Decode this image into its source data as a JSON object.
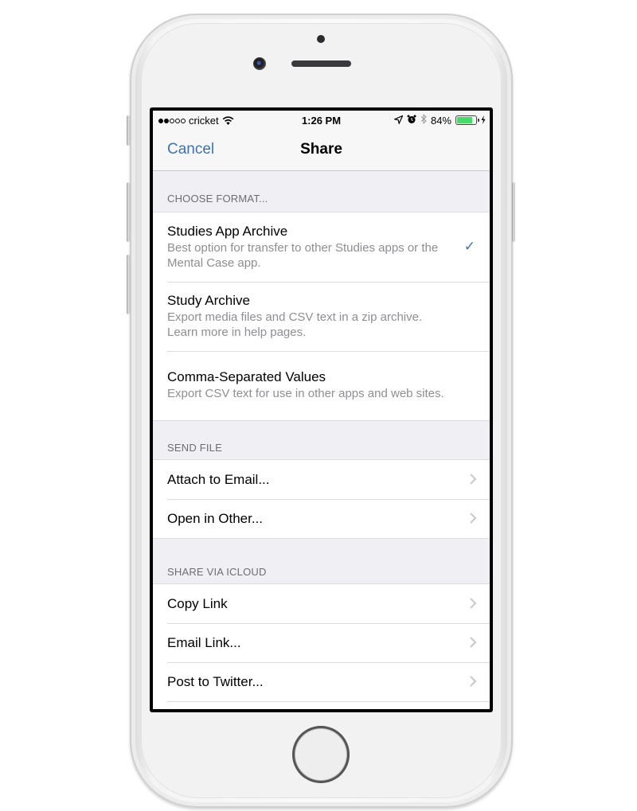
{
  "status_bar": {
    "signal_total": 5,
    "signal_filled": 2,
    "carrier": "cricket",
    "time": "1:26 PM",
    "battery_percent_label": "84%",
    "battery_level": 0.84,
    "icons": [
      "wifi-icon",
      "location-arrow-icon",
      "alarm-clock-icon",
      "bluetooth-icon",
      "battery-icon",
      "charging-bolt-icon"
    ]
  },
  "nav": {
    "cancel_label": "Cancel",
    "title": "Share"
  },
  "colors": {
    "accent": "#3d74ad",
    "battery_green": "#4cd964",
    "grouped_background": "#efeff4",
    "secondary_text": "#8e8e93"
  },
  "sections": {
    "format": {
      "header": "Choose Format...",
      "items": [
        {
          "title": "Studies App Archive",
          "subtitle": "Best option for transfer to other Studies apps or the Mental Case app.",
          "selected": true
        },
        {
          "title": "Study Archive",
          "subtitle": "Export media files and CSV text in a zip archive. Learn more in help pages.",
          "selected": false
        },
        {
          "title": "Comma-Separated Values",
          "subtitle": "Export CSV text for use in other apps and web sites.",
          "selected": false
        }
      ],
      "check_glyph": "✓"
    },
    "send_file": {
      "header": "Send File",
      "items": [
        {
          "title": "Attach to Email..."
        },
        {
          "title": "Open in Other..."
        }
      ]
    },
    "icloud": {
      "header": "Share via iCloud",
      "items": [
        {
          "title": "Copy Link"
        },
        {
          "title": "Email Link..."
        },
        {
          "title": "Post to Twitter..."
        }
      ]
    }
  }
}
